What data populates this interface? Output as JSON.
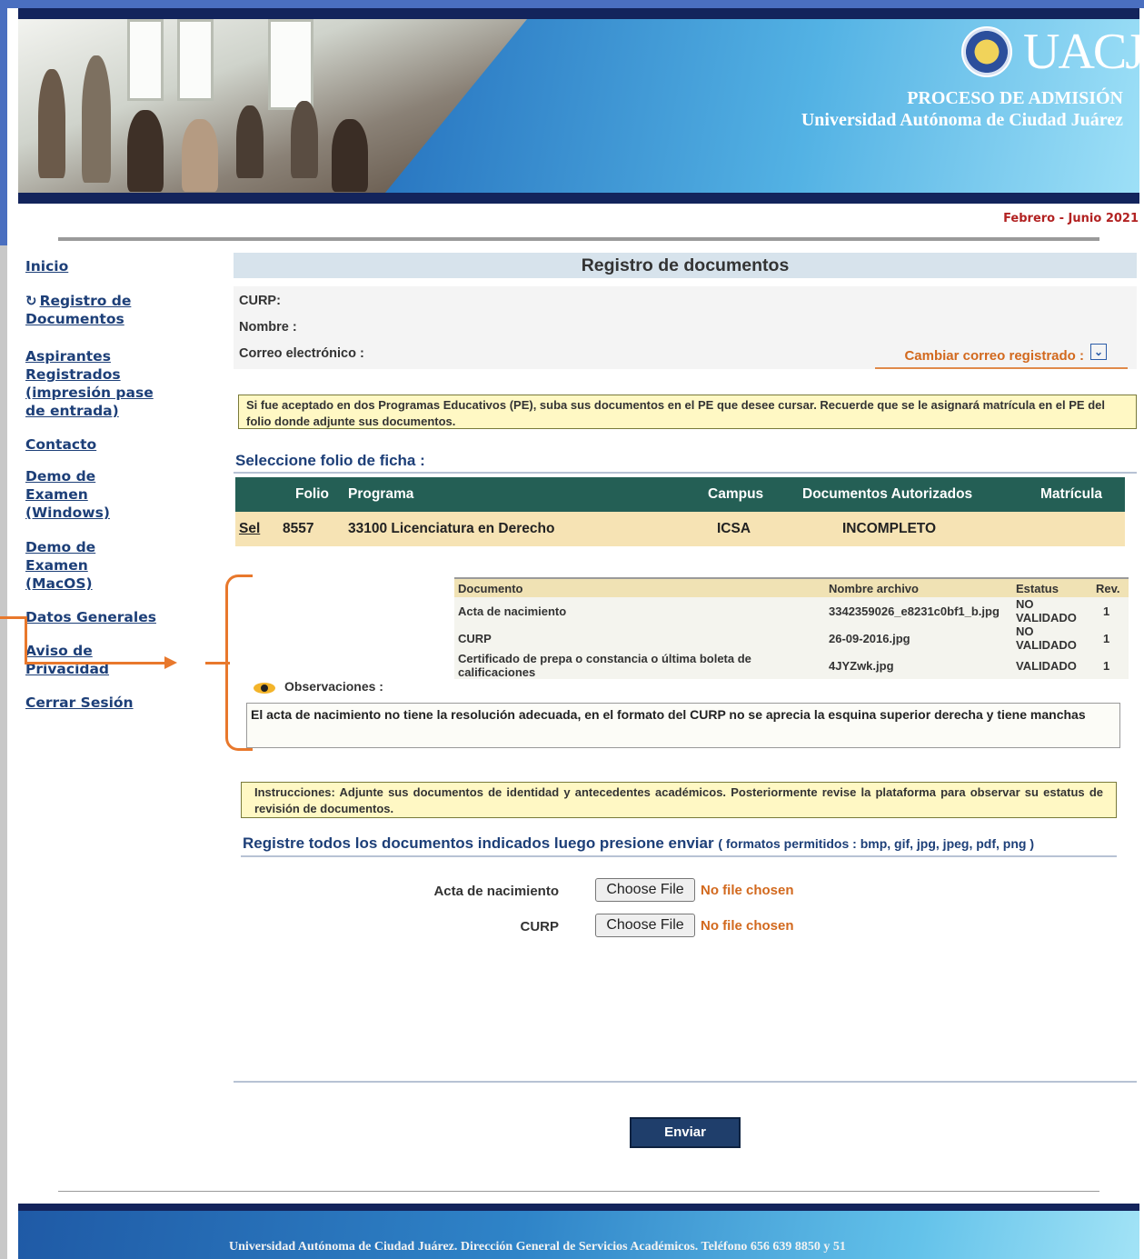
{
  "header": {
    "logo_text": "UACJ",
    "subtitle": "PROCESO DE ADMISIÓN",
    "university": "Universidad Autónoma de Ciudad Juárez",
    "period": "Febrero - Junio 2021"
  },
  "sidebar": {
    "items": [
      {
        "label": "Inicio"
      },
      {
        "label": "Registro de Documentos"
      },
      {
        "label": "Aspirantes Registrados (impresión pase de entrada)"
      },
      {
        "label": "Contacto"
      },
      {
        "label": "Demo de Examen (Windows)"
      },
      {
        "label": "Demo de Examen (MacOS)"
      },
      {
        "label": "Datos Generales"
      },
      {
        "label": "Aviso de Privacidad"
      },
      {
        "label": "Cerrar Sesión"
      }
    ]
  },
  "main": {
    "title": "Registro de documentos",
    "curp_label": "CURP:",
    "nombre_label": "Nombre :",
    "correo_label": "Correo electrónico :",
    "change_email": "Cambiar correo registrado :",
    "notice1": "Si fue aceptado en dos Programas Educativos (PE), suba sus documentos en el PE que desee cursar. Recuerde que se le asignará matrícula en el PE del folio donde adjunte sus documentos.",
    "select_title": "Seleccione folio de ficha :",
    "folio_headers": [
      "",
      "Folio",
      "Programa",
      "Campus",
      "Documentos Autorizados",
      "Matrícula"
    ],
    "folio_row": {
      "sel": "Sel",
      "folio": "8557",
      "programa": "33100 Licenciatura en Derecho",
      "campus": "ICSA",
      "documentos": "INCOMPLETO",
      "matricula": ""
    },
    "doc_headers": [
      "Documento",
      "Nombre archivo",
      "Estatus",
      "Rev."
    ],
    "doc_rows": [
      [
        "Acta de nacimiento",
        "3342359026_e8231c0bf1_b.jpg",
        "NO VALIDADO",
        "1"
      ],
      [
        "CURP",
        "26-09-2016.jpg",
        "NO VALIDADO",
        "1"
      ],
      [
        "Certificado de prepa o constancia o última boleta de calificaciones",
        "4JYZwk.jpg",
        "VALIDADO",
        "1"
      ]
    ],
    "observaciones_label": "Observaciones :",
    "observaciones_text": "El acta de nacimiento no tiene la resolución adecuada, en el formato del CURP no se aprecia la esquina superior derecha y tiene manchas",
    "instructions": "Instrucciones: Adjunte sus documentos de identidad y antecedentes académicos. Posteriormente revise la plataforma para observar su estatus de revisión de documentos.",
    "upload_title": "Registre todos los documentos indicados luego presione enviar",
    "upload_formats": "( formatos permitidos : bmp, gif, jpg, jpeg, pdf, png )",
    "uploads": [
      {
        "label": "Acta de nacimiento",
        "button": "Choose File",
        "status": "No file chosen"
      },
      {
        "label": "CURP",
        "button": "Choose File",
        "status": "No file chosen"
      }
    ],
    "send_button": "Enviar"
  },
  "footer": {
    "text": "Universidad Autónoma de Ciudad Juárez. Dirección General de Servicios Académicos. Teléfono 656 639 8850 y 51"
  },
  "colors": {
    "accent_navy": "#1d3f78",
    "table_header": "#245f55",
    "highlight_row": "#f6e3b4",
    "annotation": "#e8782c",
    "warning_text": "#d2691e"
  }
}
